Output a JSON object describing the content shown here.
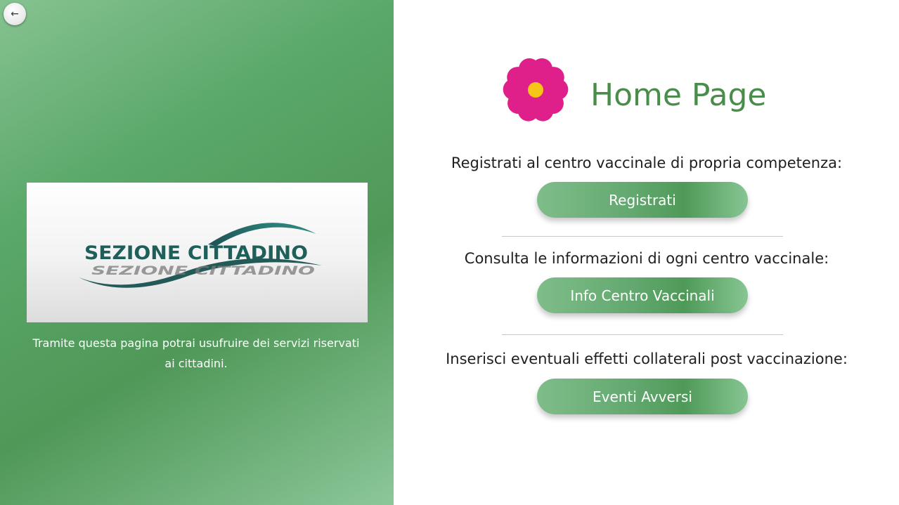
{
  "back_button": {
    "glyph": "←",
    "icon": "arrow-left-icon"
  },
  "logo": {
    "text": "SEZIONE CITTADINO",
    "reflection_text": "SEZIONE CITTADINO"
  },
  "left_panel": {
    "description": "Tramite questa pagina potrai usufruire dei servizi riservati ai cittadini."
  },
  "header": {
    "icon": "flower-icon",
    "title": "Home Page"
  },
  "sections": [
    {
      "label": "Registrati al centro vaccinale di propria competenza:",
      "button_label": "Registrati"
    },
    {
      "label": "Consulta le informazioni di ogni centro vaccinale:",
      "button_label": "Info Centro Vaccinali"
    },
    {
      "label": "Inserisci eventuali effetti collaterali post vaccinazione:",
      "button_label": "Eventi Avversi"
    }
  ],
  "colors": {
    "title": "#4a8c4a",
    "flower_petals": "#e0208a",
    "flower_center": "#f5c518",
    "logo_text": "#1f5f5a"
  }
}
